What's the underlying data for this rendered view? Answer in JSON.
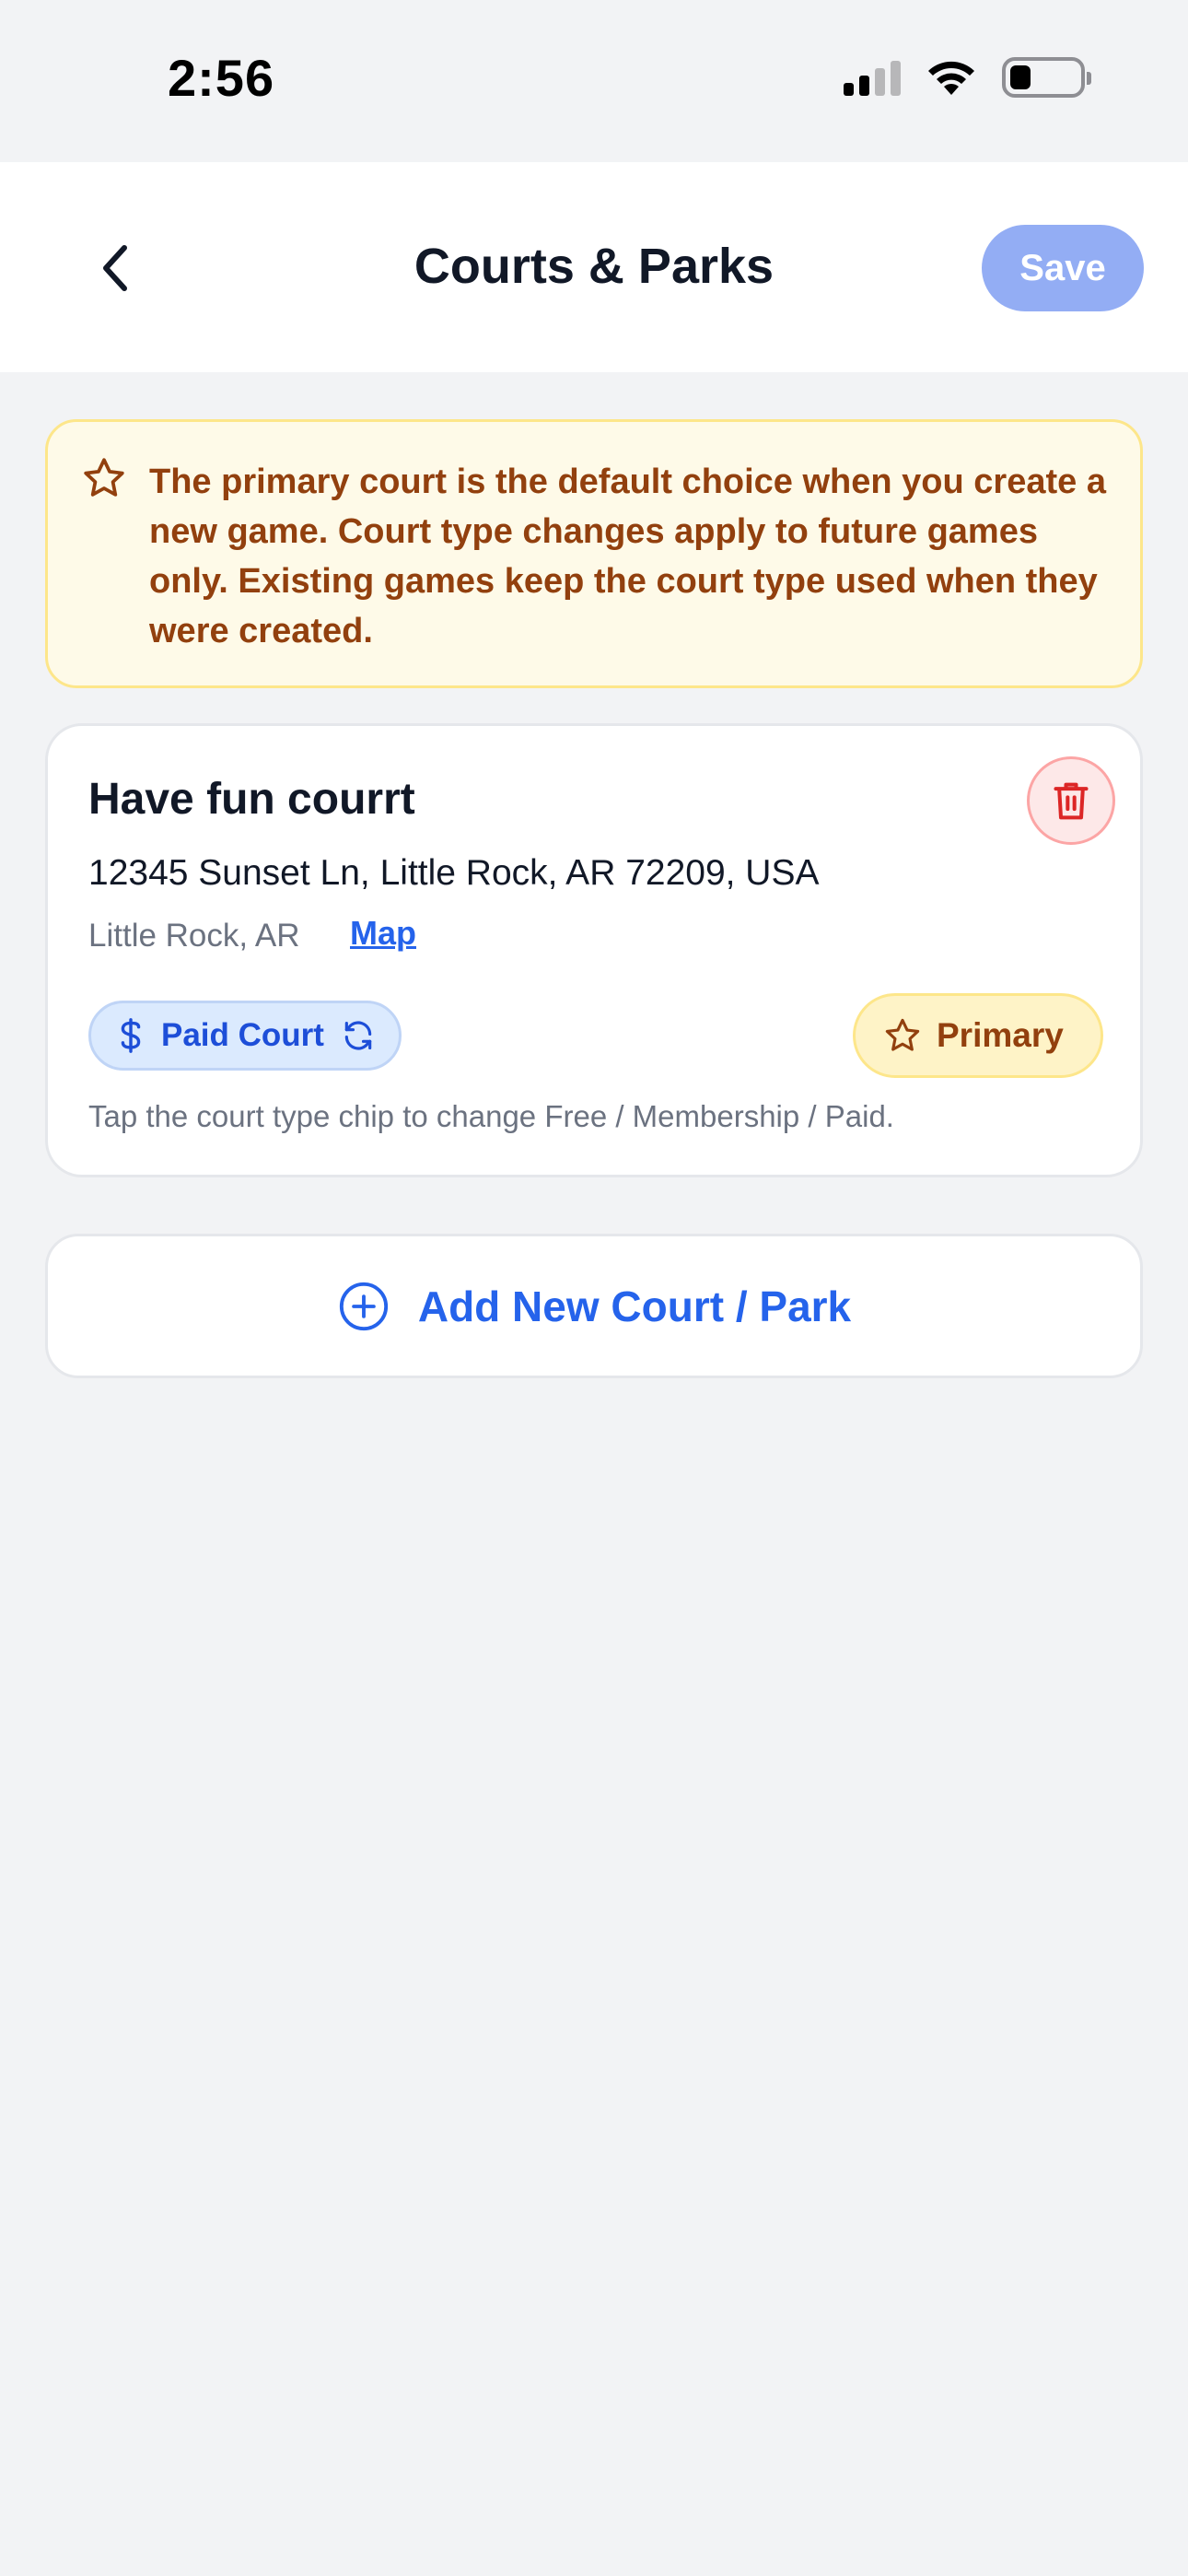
{
  "status_bar": {
    "time": "2:56",
    "icons": [
      "cellular-signal-icon",
      "wifi-icon",
      "battery-icon"
    ]
  },
  "nav": {
    "back_icon": "chevron-left-icon",
    "title": "Courts & Parks",
    "save_label": "Save"
  },
  "info_banner": {
    "icon": "star-outline-icon",
    "text": "The primary court is the default choice when you create a new game. Court type changes apply to future games only. Existing games keep the court type used when they were created."
  },
  "courts": [
    {
      "name": "Have fun courrt",
      "address": "12345 Sunset Ln, Little Rock, AR 72209, USA",
      "city": "Little Rock, AR",
      "map_label": "Map",
      "type_chip": {
        "icon": "dollar-icon",
        "label": "Paid Court",
        "swap_icon": "refresh-icon"
      },
      "primary_badge": {
        "icon": "star-outline-icon",
        "label": "Primary"
      },
      "hint": "Tap the court type chip to change Free / Membership / Paid.",
      "delete_icon": "trash-icon"
    }
  ],
  "add_button": {
    "icon": "plus-circle-icon",
    "label": "Add New Court / Park"
  },
  "colors": {
    "background": "#f2f3f5",
    "accent_blue": "#2563eb",
    "save_disabled": "#93adf4",
    "banner_bg": "#fefae8",
    "banner_text": "#92400e",
    "delete_red": "#dc2626"
  }
}
